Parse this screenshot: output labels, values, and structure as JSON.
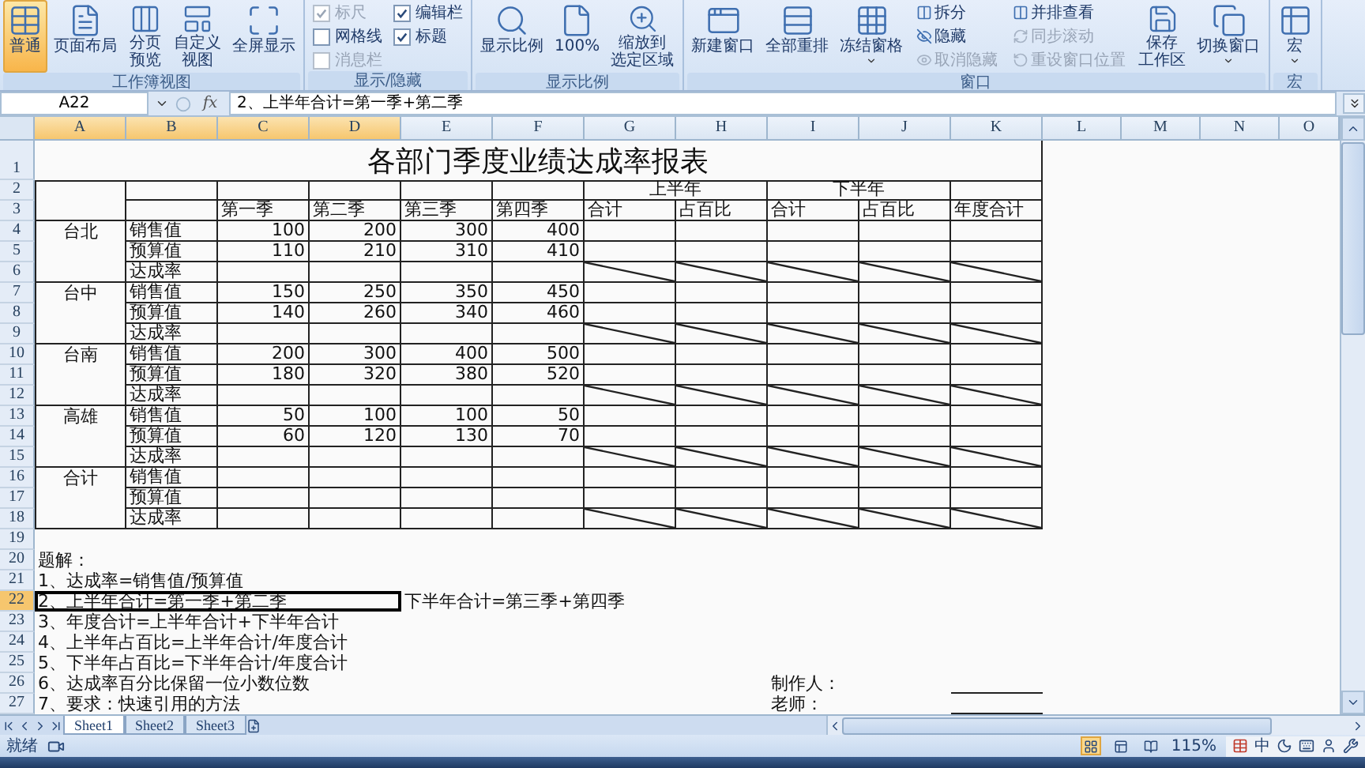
{
  "ribbon": {
    "groups": [
      {
        "label": "工作簿视图",
        "items": [
          {
            "kind": "large",
            "lines": [
              "普通"
            ],
            "selected": true,
            "dropdown": false
          },
          {
            "kind": "large",
            "lines": [
              "页面布局"
            ],
            "selected": false,
            "dropdown": false
          },
          {
            "kind": "large",
            "lines": [
              "分页",
              "预览"
            ],
            "selected": false,
            "dropdown": false
          },
          {
            "kind": "large",
            "lines": [
              "自定义",
              "视图"
            ],
            "selected": false,
            "dropdown": false
          },
          {
            "kind": "large",
            "lines": [
              "全屏显示"
            ],
            "selected": false,
            "dropdown": false
          }
        ]
      },
      {
        "label": "显示/隐藏",
        "items": [
          {
            "kind": "checkbox",
            "lines": [
              "标尺"
            ],
            "checked": true,
            "disabled": true
          },
          {
            "kind": "checkbox",
            "lines": [
              "网格线"
            ],
            "checked": false,
            "disabled": false
          },
          {
            "kind": "checkbox",
            "lines": [
              "消息栏"
            ],
            "checked": false,
            "disabled": true
          },
          {
            "kind": "checkbox",
            "lines": [
              "编辑栏"
            ],
            "checked": true,
            "disabled": false
          },
          {
            "kind": "checkbox",
            "lines": [
              "标题"
            ],
            "checked": true,
            "disabled": false
          }
        ]
      },
      {
        "label": "显示比例",
        "items": [
          {
            "kind": "large",
            "lines": [
              "显示比例"
            ],
            "selected": false,
            "dropdown": false
          },
          {
            "kind": "large",
            "lines": [
              "100%"
            ],
            "selected": false,
            "dropdown": false
          },
          {
            "kind": "large",
            "lines": [
              "缩放到",
              "选定区域"
            ],
            "selected": false,
            "dropdown": false
          }
        ]
      },
      {
        "label": "窗口",
        "items": [
          {
            "kind": "large",
            "lines": [
              "新建窗口"
            ],
            "selected": false,
            "dropdown": false
          },
          {
            "kind": "large",
            "lines": [
              "全部重排"
            ],
            "selected": false,
            "dropdown": false
          },
          {
            "kind": "large",
            "lines": [
              "冻结窗格"
            ],
            "selected": false,
            "dropdown": true
          },
          {
            "kind": "small",
            "lines": [
              "拆分"
            ],
            "disabled": false
          },
          {
            "kind": "small",
            "lines": [
              "隐藏"
            ],
            "disabled": false
          },
          {
            "kind": "small",
            "lines": [
              "取消隐藏"
            ],
            "disabled": true
          },
          {
            "kind": "small",
            "lines": [
              "并排查看"
            ],
            "disabled": false
          },
          {
            "kind": "small",
            "lines": [
              "同步滚动"
            ],
            "disabled": true
          },
          {
            "kind": "small",
            "lines": [
              "重设窗口位置"
            ],
            "disabled": true
          },
          {
            "kind": "large",
            "lines": [
              "保存",
              "工作区"
            ],
            "selected": false,
            "dropdown": false
          },
          {
            "kind": "large",
            "lines": [
              "切换窗口"
            ],
            "selected": false,
            "dropdown": true
          }
        ]
      },
      {
        "label": "宏",
        "items": [
          {
            "kind": "large",
            "lines": [
              "宏"
            ],
            "selected": false,
            "dropdown": true
          }
        ]
      }
    ]
  },
  "formula_bar": {
    "name_box": "A22",
    "function_label": "fx",
    "formula": "2、上半年合计=第一季+第二季"
  },
  "columns": [
    {
      "label": "A",
      "selected": true
    },
    {
      "label": "B",
      "selected": true
    },
    {
      "label": "C",
      "selected": true
    },
    {
      "label": "D",
      "selected": true
    },
    {
      "label": "E",
      "selected": false
    },
    {
      "label": "F",
      "selected": false
    },
    {
      "label": "G",
      "selected": false
    },
    {
      "label": "H",
      "selected": false
    },
    {
      "label": "I",
      "selected": false
    },
    {
      "label": "J",
      "selected": false
    },
    {
      "label": "K",
      "selected": false
    },
    {
      "label": "L",
      "selected": false
    },
    {
      "label": "M",
      "selected": false
    },
    {
      "label": "N",
      "selected": false
    },
    {
      "label": "O",
      "selected": false
    }
  ],
  "row_numbers": [
    {
      "label": "1",
      "selected": false
    },
    {
      "label": "2",
      "selected": false
    },
    {
      "label": "3",
      "selected": false
    },
    {
      "label": "4",
      "selected": false
    },
    {
      "label": "5",
      "selected": false
    },
    {
      "label": "6",
      "selected": false
    },
    {
      "label": "7",
      "selected": false
    },
    {
      "label": "8",
      "selected": false
    },
    {
      "label": "9",
      "selected": false
    },
    {
      "label": "10",
      "selected": false
    },
    {
      "label": "11",
      "selected": false
    },
    {
      "label": "12",
      "selected": false
    },
    {
      "label": "13",
      "selected": false
    },
    {
      "label": "14",
      "selected": false
    },
    {
      "label": "15",
      "selected": false
    },
    {
      "label": "16",
      "selected": false
    },
    {
      "label": "17",
      "selected": false
    },
    {
      "label": "18",
      "selected": false
    },
    {
      "label": "19",
      "selected": false
    },
    {
      "label": "20",
      "selected": false
    },
    {
      "label": "21",
      "selected": false
    },
    {
      "label": "22",
      "selected": true
    },
    {
      "label": "23",
      "selected": false
    },
    {
      "label": "24",
      "selected": false
    },
    {
      "label": "25",
      "selected": false
    },
    {
      "label": "26",
      "selected": false
    },
    {
      "label": "27",
      "selected": false
    }
  ],
  "sheet": {
    "title": "各部门季度业绩达成率报表",
    "half_headers": [
      "上半年",
      "下半年"
    ],
    "column_headers": [
      "第一季",
      "第二季",
      "第三季",
      "第四季",
      "合计",
      "占百比",
      "合计",
      "占百比",
      "年度合计"
    ],
    "regions": [
      {
        "name": "台北",
        "rows": [
          {
            "kind": "amount",
            "label": "销售值",
            "values": [
              "100",
              "200",
              "300",
              "400"
            ]
          },
          {
            "kind": "amount",
            "label": "预算值",
            "values": [
              "110",
              "210",
              "310",
              "410"
            ]
          },
          {
            "kind": "rate",
            "label": "达成率"
          }
        ]
      },
      {
        "name": "台中",
        "rows": [
          {
            "kind": "amount",
            "label": "销售值",
            "values": [
              "150",
              "250",
              "350",
              "450"
            ]
          },
          {
            "kind": "amount",
            "label": "预算值",
            "values": [
              "140",
              "260",
              "340",
              "460"
            ]
          },
          {
            "kind": "rate",
            "label": "达成率"
          }
        ]
      },
      {
        "name": "台南",
        "rows": [
          {
            "kind": "amount",
            "label": "销售值",
            "values": [
              "200",
              "300",
              "400",
              "500"
            ]
          },
          {
            "kind": "amount",
            "label": "预算值",
            "values": [
              "180",
              "320",
              "380",
              "520"
            ]
          },
          {
            "kind": "rate",
            "label": "达成率"
          }
        ]
      },
      {
        "name": "高雄",
        "rows": [
          {
            "kind": "amount",
            "label": "销售值",
            "values": [
              "50",
              "100",
              "100",
              "50"
            ]
          },
          {
            "kind": "amount",
            "label": "预算值",
            "values": [
              "60",
              "120",
              "130",
              "70"
            ]
          },
          {
            "kind": "rate",
            "label": "达成率"
          }
        ]
      },
      {
        "name": "合计",
        "rows": [
          {
            "kind": "amount",
            "label": "销售值"
          },
          {
            "kind": "amount",
            "label": "预算值"
          },
          {
            "kind": "rate",
            "label": "达成率"
          }
        ]
      }
    ],
    "notes": [
      {
        "text": "题解：",
        "selected": false
      },
      {
        "text": "1、达成率=销售值/预算值",
        "selected": false
      },
      {
        "text": "2、上半年合计=第一季+第二季",
        "selected": true,
        "aside": "下半年合计=第三季+第四季"
      },
      {
        "text": "3、年度合计=上半年合计+下半年合计",
        "selected": false
      },
      {
        "text": "4、上半年占百比=上半年合计/年度合计",
        "selected": false
      },
      {
        "text": "5、下半年占百比=下半年合计/年度合计",
        "selected": false
      },
      {
        "text": "6、达成率百分比保留一位小数位数",
        "selected": false,
        "signature": "制作人："
      },
      {
        "text": "7、要求：快速引用的方法",
        "selected": false,
        "signature": "老师："
      }
    ]
  },
  "sheet_tabs": [
    {
      "label": "Sheet1",
      "selected": true
    },
    {
      "label": "Sheet2",
      "selected": false
    },
    {
      "label": "Sheet3",
      "selected": false
    }
  ],
  "status_bar": {
    "text": "就绪",
    "views": [
      {
        "selected": true
      },
      {
        "selected": false
      },
      {
        "selected": false
      }
    ],
    "zoom": "115%",
    "ime": "中"
  }
}
